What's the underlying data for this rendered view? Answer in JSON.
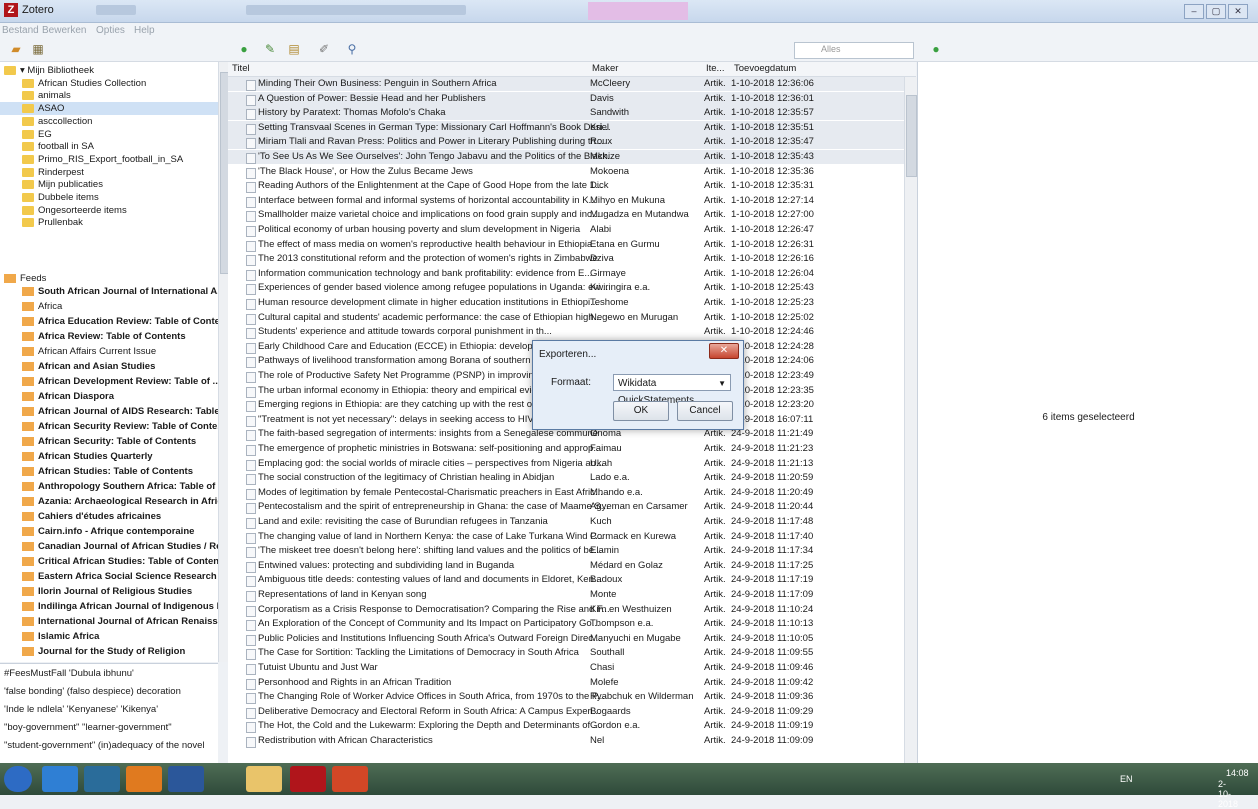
{
  "window": {
    "app_title": "Zotero",
    "logo_letter": "Z",
    "controls": [
      "–",
      "▢",
      "✕"
    ]
  },
  "menubar": [
    "Bestand",
    "Bewerken",
    "Opties",
    "Help"
  ],
  "search": {
    "placeholder": "Alles"
  },
  "library": {
    "root": "Mijn Bibliotheek",
    "collections": [
      "African Studies Collection",
      "animals",
      "ASAO",
      "asccollection",
      "EG",
      "football in SA",
      "Primo_RIS_Export_football_in_SA",
      "Rinderpest"
    ],
    "special": [
      "Mijn publicaties",
      "Dubbele items",
      "Ongesorteerde items",
      "Prullenbak"
    ],
    "selected_collection": "ASAO"
  },
  "feeds": {
    "header": "Feeds",
    "items": [
      "South African Journal of International A...",
      "Africa",
      "Africa Education Review: Table of Conte...",
      "Africa Review: Table of Contents",
      "African Affairs Current Issue",
      "African and Asian Studies",
      "African Development Review: Table of ...",
      "African Diaspora",
      "African Journal of AIDS Research: Table ...",
      "African Security Review: Table of Conte...",
      "African Security: Table of Contents",
      "African Studies Quarterly",
      "African Studies: Table of Contents",
      "Anthropology Southern Africa: Table of ...",
      "Azania: Archaeological Research in Afric...",
      "Cahiers d'études africaines",
      "Cairn.info - Afrique contemporaine",
      "Canadian Journal of African Studies / Re...",
      "Critical African Studies: Table of Contents",
      "Eastern Africa Social Science Research R...",
      "Ilorin Journal of Religious Studies",
      "Indilinga African Journal of Indigenous K...",
      "International Journal of African Renaissa...",
      "Islamic Africa",
      "Journal for the Study of Religion"
    ]
  },
  "tags": [
    "#FeesMustFall 'Dubula ibhunu'",
    "'false bonding' (falso despiece) decoration",
    "'Inde le ndlela' 'Kenyanese' 'Kikenya'",
    "\"boy-government\" \"learner-government\"",
    "\"student-government\" (in)adequacy of the novel"
  ],
  "columns": {
    "title": "Titel",
    "creator": "Maker",
    "type": "Ite...",
    "date_added": "Toevoegdatum"
  },
  "items": [
    [
      "Minding Their Own Business: Penguin in Southern Africa",
      "McCleery",
      "Artik...",
      "1-10-2018 12:36:06"
    ],
    [
      "A Question of Power: Bessie Head and her Publishers",
      "Davis",
      "Artik...",
      "1-10-2018 12:36:01"
    ],
    [
      "History by Paratext: Thomas Mofolo's Chaka",
      "Sandwith",
      "Artik...",
      "1-10-2018 12:35:57"
    ],
    [
      "Setting Transvaal Scenes in German Type: Missionary Carl Hoffmann's Book Desi...",
      "Kriel",
      "Artik...",
      "1-10-2018 12:35:51"
    ],
    [
      "Miriam Tlali and Ravan Press: Politics and Power in Literary Publishing during th...",
      "Roux",
      "Artik...",
      "1-10-2018 12:35:47"
    ],
    [
      "'To See Us As We See Ourselves': John Tengo Jabavu and the Politics of the Black...",
      "Mkhize",
      "Artik...",
      "1-10-2018 12:35:43"
    ],
    [
      "'The Black House', or How the Zulus Became Jews",
      "Mokoena",
      "Artik...",
      "1-10-2018 12:35:36"
    ],
    [
      "Reading Authors of the Enlightenment at the Cape of Good Hope from the late 1...",
      "Dick",
      "Artik...",
      "1-10-2018 12:35:31"
    ],
    [
      "Interface between formal and informal systems of horizontal accountability in K...",
      "Mihyo en Mukuna",
      "Artik...",
      "1-10-2018 12:27:14"
    ],
    [
      "Smallholder maize varietal choice and implications on food grain supply and inc...",
      "Mugadza en Mutandwa",
      "Artik...",
      "1-10-2018 12:27:00"
    ],
    [
      "Political economy of urban housing poverty and slum development in Nigeria",
      "Alabi",
      "Artik...",
      "1-10-2018 12:26:47"
    ],
    [
      "The effect of mass media on women's reproductive health behaviour in Ethiopia",
      "Etana en Gurmu",
      "Artik...",
      "1-10-2018 12:26:31"
    ],
    [
      "The 2013 constitutional reform and the protection of women's rights in Zimbabwe",
      "Dziva",
      "Artik...",
      "1-10-2018 12:26:16"
    ],
    [
      "Information communication technology and bank profitability: evidence from E...",
      "Girmaye",
      "Artik...",
      "1-10-2018 12:26:04"
    ],
    [
      "Experiences of gender based violence among refugee populations in Uganda: evi...",
      "Kwiringira e.a.",
      "Artik...",
      "1-10-2018 12:25:43"
    ],
    [
      "Human resource development climate in higher education institutions in Ethiopi...",
      "Teshome",
      "Artik...",
      "1-10-2018 12:25:23"
    ],
    [
      "Cultural capital and students' academic performance: the case of Ethiopian high...",
      "Negewo en Murugan",
      "Artik...",
      "1-10-2018 12:25:02"
    ],
    [
      "Students' experience and attitude towards corporal punishment in th...",
      "",
      "Artik...",
      "1-10-2018 12:24:46"
    ],
    [
      "Early Childhood Care and Education (ECCE) in Ethiopia: development...",
      "",
      "Artik...",
      "1-10-2018 12:24:28"
    ],
    [
      "Pathways of livelihood transformation among Borana of southern Et...",
      "",
      "Artik...",
      "1-10-2018 12:24:06"
    ],
    [
      "The role of Productive Safety Net Programme (PSNP) in improving f...",
      "",
      "Artik...",
      "1-10-2018 12:23:49"
    ],
    [
      "The urban informal economy in Ethiopia: theory and empirical evide...",
      "",
      "Artik...",
      "1-10-2018 12:23:35"
    ],
    [
      "Emerging regions in Ethiopia: are they catching up with the rest of Et...",
      "",
      "Artik...",
      "1-10-2018 12:23:20"
    ],
    [
      "\"Treatment is not yet necessary\": delays in seeking access to HIV treatment in Ug...",
      "Kautuma e.a.",
      "Artik...",
      "27-9-2018 16:07:11"
    ],
    [
      "The faith-based segregation of interments: insights from a Senegalese commune",
      "Onoma",
      "Artik...",
      "24-9-2018 11:21:49"
    ],
    [
      "The emergence of prophetic ministries in Botswana: self-positioning and approp...",
      "Faimau",
      "Artik...",
      "24-9-2018 11:21:23"
    ],
    [
      "Emplacing god: the social worlds of miracle cities – perspectives from Nigeria an...",
      "Ukah",
      "Artik...",
      "24-9-2018 11:21:13"
    ],
    [
      "The social construction of the legitimacy of Christian healing in Abidjan",
      "Lado e.a.",
      "Artik...",
      "24-9-2018 11:20:59"
    ],
    [
      "Modes of legitimation by female Pentecostal-Charismatic preachers in East Afric...",
      "Mhando e.a.",
      "Artik...",
      "24-9-2018 11:20:49"
    ],
    [
      "Pentecostalism and the spirit of entrepreneurship in Ghana: the case of Maame S...",
      "Agyeman en Carsamer",
      "Artik...",
      "24-9-2018 11:20:44"
    ],
    [
      "Land and exile: revisiting the case of Burundian refugees in Tanzania",
      "Kuch",
      "Artik...",
      "24-9-2018 11:17:48"
    ],
    [
      "The changing value of land in Northern Kenya: the case of Lake Turkana Wind P...",
      "Cormack en Kurewa",
      "Artik...",
      "24-9-2018 11:17:40"
    ],
    [
      "'The miskeet tree doesn't belong here': shifting land values and the politics of be...",
      "Elamin",
      "Artik...",
      "24-9-2018 11:17:34"
    ],
    [
      "Entwined values: protecting and subdividing land in Buganda",
      "Médard en Golaz",
      "Artik...",
      "24-9-2018 11:17:25"
    ],
    [
      "Ambiguous title deeds: contesting values of land and documents in Eldoret, Ken...",
      "Badoux",
      "Artik...",
      "24-9-2018 11:17:19"
    ],
    [
      "Representations of land in Kenyan song",
      "Monte",
      "Artik...",
      "24-9-2018 11:17:09"
    ],
    [
      "Corporatism as a Crisis Response to Democratisation? Comparing the Rise and F...",
      "Kim en Westhuizen",
      "Artik...",
      "24-9-2018 11:10:24"
    ],
    [
      "An Exploration of the Concept of Community and Its Impact on Participatory Go...",
      "Thompson e.a.",
      "Artik...",
      "24-9-2018 11:10:13"
    ],
    [
      "Public Policies and Institutions Influencing South Africa's Outward Foreign Direc...",
      "Manyuchi en Mugabe",
      "Artik...",
      "24-9-2018 11:10:05"
    ],
    [
      "The Case for Sortition: Tackling the Limitations of Democracy in South Africa",
      "Southall",
      "Artik...",
      "24-9-2018 11:09:55"
    ],
    [
      "Tutuist Ubuntu and Just War",
      "Chasi",
      "Artik...",
      "24-9-2018 11:09:46"
    ],
    [
      "Personhood and Rights in an African Tradition",
      "Molefe",
      "Artik...",
      "24-9-2018 11:09:42"
    ],
    [
      "The Changing Role of Worker Advice Offices in South Africa, from 1970s to the P...",
      "Ryabchuk en Wilderman",
      "Artik...",
      "24-9-2018 11:09:36"
    ],
    [
      "Deliberative Democracy and Electoral Reform in South Africa: A Campus Experi...",
      "Bogaards",
      "Artik...",
      "24-9-2018 11:09:29"
    ],
    [
      "The Hot, the Cold and the Lukewarm: Exploring the Depth and Determinants of ...",
      "Gordon e.a.",
      "Artik...",
      "24-9-2018 11:09:19"
    ],
    [
      "Redistribution with African Characteristics",
      "Nel",
      "Artik...",
      "24-9-2018 11:09:09"
    ]
  ],
  "selected_count_rows": 6,
  "rightpane": {
    "status": "6 items geselecteerd"
  },
  "dialog": {
    "title": "Exporteren...",
    "close": "✕",
    "format_label": "Formaat:",
    "format_value": "Wikidata QuickStatements",
    "ok": "OK",
    "cancel": "Cancel"
  },
  "taskbar": {
    "lang": "EN",
    "time": "14:08",
    "date": "2-10-2018"
  },
  "colors": {
    "zotero_red": "#b0151b",
    "selection": "#cfe1f5",
    "feed_icon": "#f0a84a",
    "folder": "#f2c94c"
  }
}
